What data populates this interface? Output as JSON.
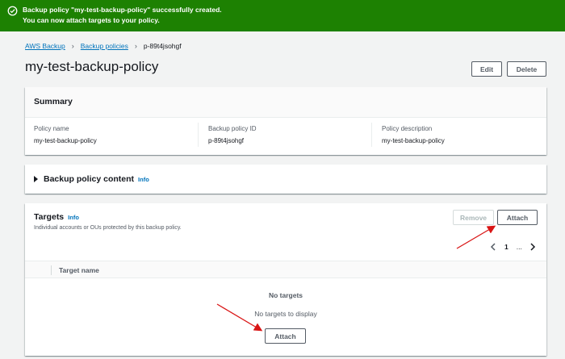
{
  "flash": {
    "line1": "Backup policy \"my-test-backup-policy\" successfully created.",
    "line2": "You can now attach targets to your policy.",
    "color": "#1d8102"
  },
  "breadcrumb": {
    "items": [
      "AWS Backup",
      "Backup policies",
      "p-89t4jsohgf"
    ]
  },
  "page": {
    "title": "my-test-backup-policy",
    "edit_label": "Edit",
    "delete_label": "Delete"
  },
  "summary": {
    "heading": "Summary",
    "fields": [
      {
        "label": "Policy name",
        "value": "my-test-backup-policy"
      },
      {
        "label": "Backup policy ID",
        "value": "p-89t4jsohgf"
      },
      {
        "label": "Policy description",
        "value": "my-test-backup-policy"
      }
    ]
  },
  "content_section": {
    "heading": "Backup policy content",
    "info_label": "Info"
  },
  "targets": {
    "heading": "Targets",
    "info_label": "Info",
    "description": "Individual accounts or OUs protected by this backup policy.",
    "remove_label": "Remove",
    "attach_label": "Attach",
    "pagination": {
      "current_page": "1",
      "ellipsis": "..."
    },
    "column_header": "Target name",
    "empty_title": "No targets",
    "empty_subtitle": "No targets to display",
    "empty_attach_label": "Attach"
  },
  "colors": {
    "link": "#0073bb",
    "annotation_arrow": "#d91515"
  },
  "icons": {
    "flash": "success-check-circle-icon",
    "breadcrumb_separator": "chevron-right-icon",
    "expander": "caret-right-icon",
    "prev_page": "chevron-left-icon",
    "next_page": "chevron-right-icon"
  }
}
